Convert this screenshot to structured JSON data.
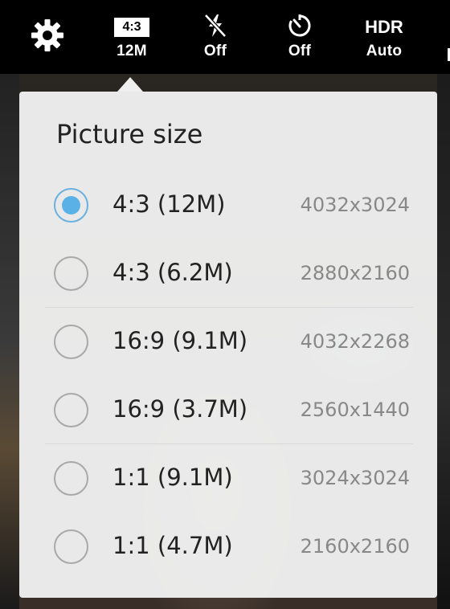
{
  "toolbar": {
    "settings_icon": "gear-icon",
    "picture_size": {
      "badge": "4:3",
      "label": "12M"
    },
    "flash": {
      "icon": "flash-off-icon",
      "label": "Off"
    },
    "timer": {
      "icon": "timer-icon",
      "label": "Off"
    },
    "hdr": {
      "title": "HDR",
      "label": "Auto"
    }
  },
  "popup": {
    "title": "Picture size",
    "selected_index": 0,
    "accent_color": "#5ab1e6",
    "options": [
      {
        "label": "4:3 (12M)",
        "resolution": "4032x3024"
      },
      {
        "label": "4:3 (6.2M)",
        "resolution": "2880x2160"
      },
      {
        "label": "16:9 (9.1M)",
        "resolution": "4032x2268"
      },
      {
        "label": "16:9 (3.7M)",
        "resolution": "2560x1440"
      },
      {
        "label": "1:1 (9.1M)",
        "resolution": "3024x3024"
      },
      {
        "label": "1:1 (4.7M)",
        "resolution": "2160x2160"
      }
    ]
  }
}
